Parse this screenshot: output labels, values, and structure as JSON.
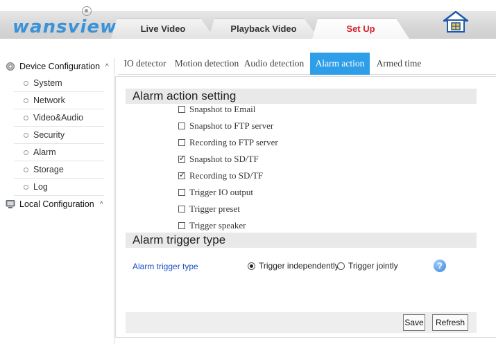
{
  "header": {
    "logo_text": "wansview",
    "tabs": [
      {
        "label": "Live Video"
      },
      {
        "label": "Playback Video"
      },
      {
        "label": "Set Up",
        "active": true
      }
    ],
    "home_icon": "home-icon",
    "active_color": "#d1202f"
  },
  "sidebar": {
    "groups": [
      {
        "label": "Device Configuration",
        "caret": "^",
        "icon": "gear-icon"
      },
      {
        "label": "Local Configuration",
        "caret": "^",
        "icon": "computer-icon"
      }
    ],
    "items": [
      {
        "label": "System"
      },
      {
        "label": "Network"
      },
      {
        "label": "Video&Audio"
      },
      {
        "label": "Security"
      },
      {
        "label": "Alarm"
      },
      {
        "label": "Storage"
      },
      {
        "label": "Log"
      }
    ]
  },
  "subtabs": [
    {
      "label": "IO detector"
    },
    {
      "label": "Motion detection"
    },
    {
      "label": "Audio detection"
    },
    {
      "label": "Alarm action",
      "active": true
    },
    {
      "label": "Armed time"
    }
  ],
  "alarm_action": {
    "title": "Alarm action setting",
    "options": [
      {
        "label": "Snapshot to Email",
        "checked": false
      },
      {
        "label": "Snapshot to FTP server",
        "checked": false
      },
      {
        "label": "Recording to FTP server",
        "checked": false
      },
      {
        "label": "Snapshot to SD/TF",
        "checked": true
      },
      {
        "label": "Recording to SD/TF",
        "checked": true
      },
      {
        "label": "Trigger IO output",
        "checked": false
      },
      {
        "label": "Trigger  preset",
        "checked": false
      },
      {
        "label": "Trigger  speaker",
        "checked": false
      }
    ]
  },
  "trigger": {
    "title": "Alarm trigger type",
    "label": "Alarm trigger type",
    "options": [
      {
        "label": "Trigger independently",
        "selected": true
      },
      {
        "label": "Trigger jointly",
        "selected": false
      }
    ],
    "help_icon": "help-icon",
    "help_glyph": "?"
  },
  "buttons": {
    "save": "Save",
    "refresh": "Refresh"
  },
  "colors": {
    "accent": "#2e9ee8",
    "link": "#1a4fc4",
    "logo": "#3a92d8"
  }
}
